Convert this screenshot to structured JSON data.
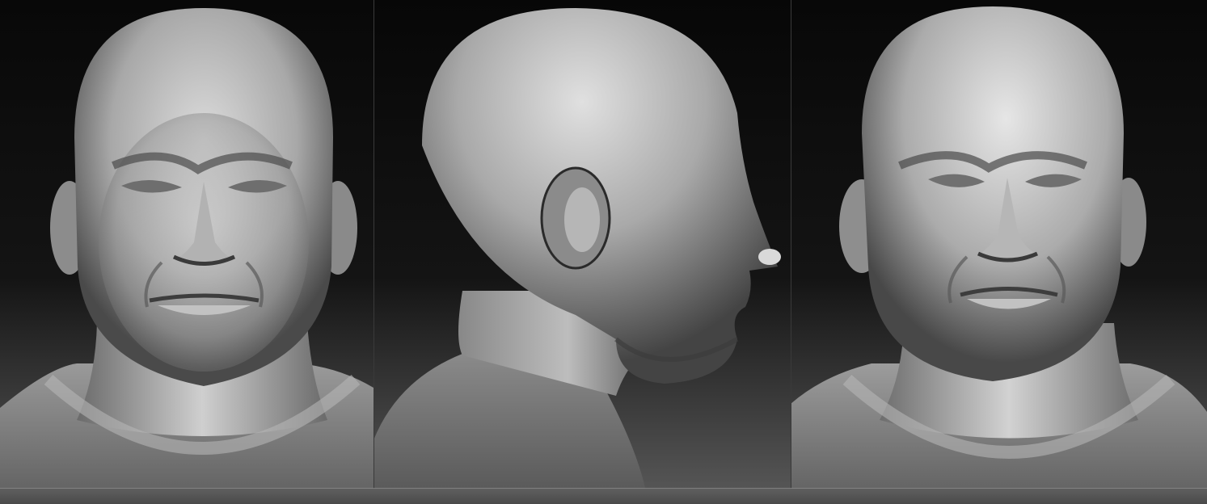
{
  "scene": {
    "description_free": true,
    "panels": [
      {
        "view": "front"
      },
      {
        "view": "side"
      },
      {
        "view": "front-lit"
      }
    ],
    "colors": {
      "background_top": "#0a0a0a",
      "background_bottom": "#5a5a5a",
      "skin_light": "#d9d9d9",
      "skin_mid": "#9a9a9a",
      "skin_dark": "#3c3c3c"
    }
  }
}
